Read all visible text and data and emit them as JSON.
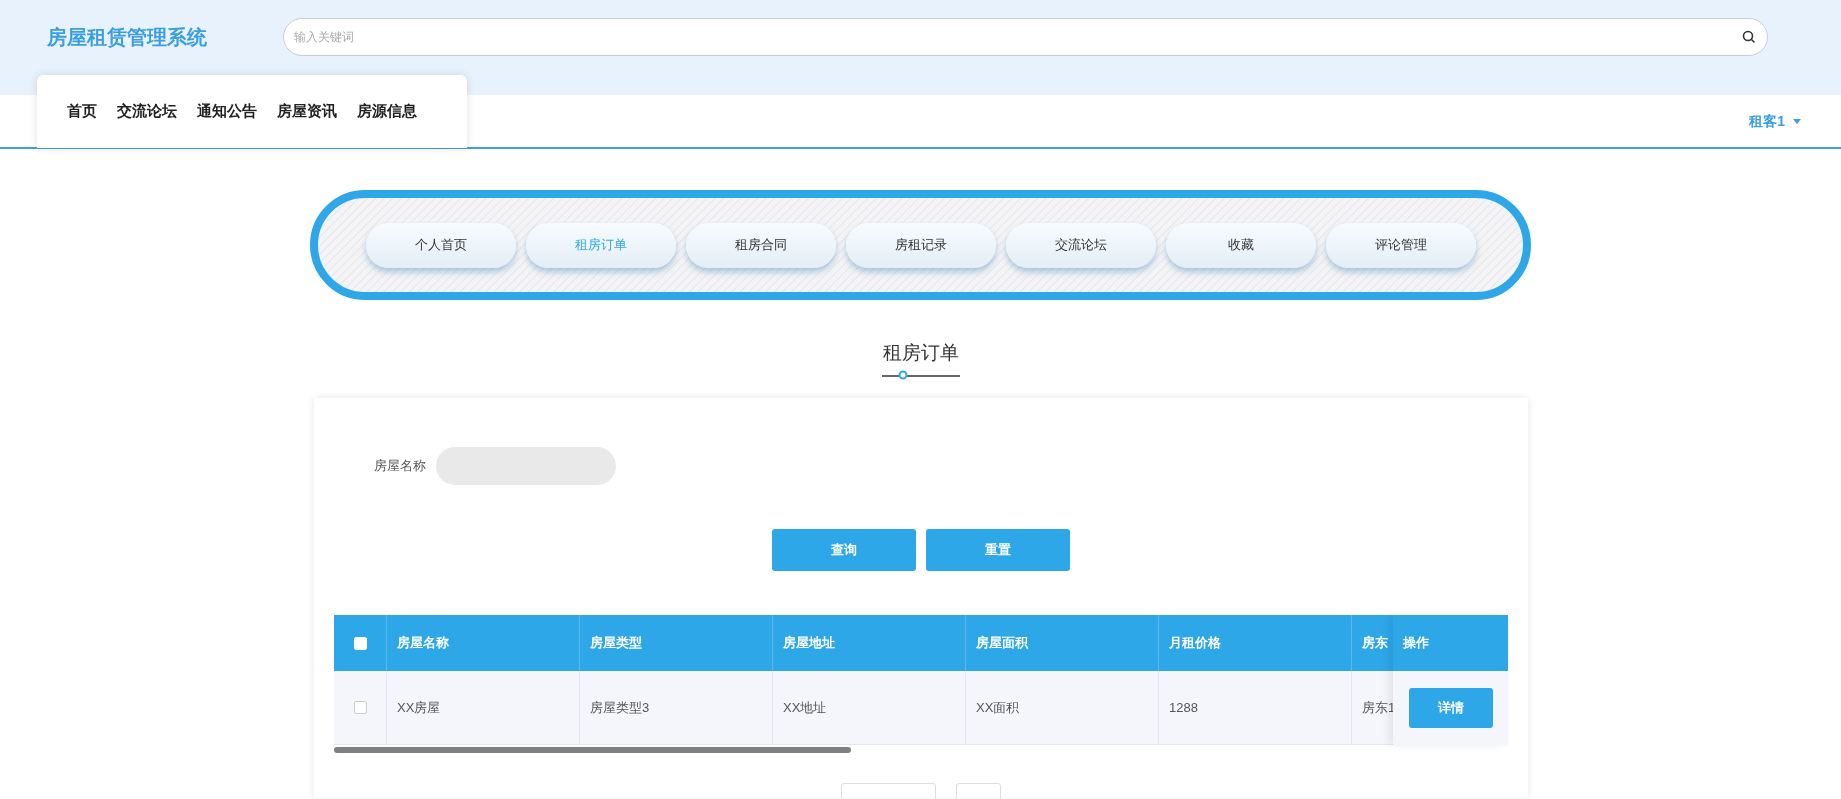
{
  "header": {
    "logo": "房屋租赁管理系统",
    "search": {
      "placeholder": "输入关键词"
    }
  },
  "nav": {
    "items": [
      {
        "label": "首页"
      },
      {
        "label": "交流论坛"
      },
      {
        "label": "通知公告"
      },
      {
        "label": "房屋资讯"
      },
      {
        "label": "房源信息"
      }
    ],
    "user": "租客1"
  },
  "tabs": [
    {
      "label": "个人首页",
      "selected": false
    },
    {
      "label": "租房订单",
      "selected": true
    },
    {
      "label": "租房合同",
      "selected": false
    },
    {
      "label": "房租记录",
      "selected": false
    },
    {
      "label": "交流论坛",
      "selected": false
    },
    {
      "label": "收藏",
      "selected": false
    },
    {
      "label": "评论管理",
      "selected": false
    }
  ],
  "page_title": "租房订单",
  "filter": {
    "label": "房屋名称",
    "buttons": [
      "查询",
      "重置"
    ]
  },
  "table": {
    "select_all_checked": false,
    "columns": [
      "房屋名称",
      "房屋类型",
      "房屋地址",
      "房屋面积",
      "月租价格",
      "房东"
    ],
    "action_column": "操作",
    "rows": [
      {
        "checked": false,
        "cells": [
          "XX房屋",
          "房屋类型3",
          "XX地址",
          "XX面积",
          "1288",
          "房东1"
        ],
        "action": "详情"
      }
    ]
  }
}
